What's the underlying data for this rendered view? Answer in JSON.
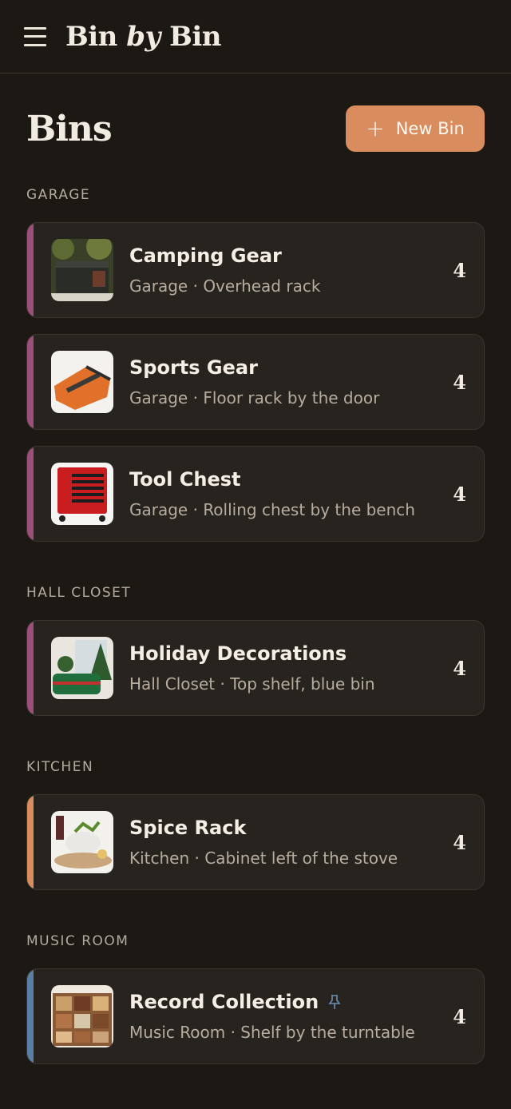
{
  "app": {
    "title_part1": "Bin ",
    "title_part2": "by",
    "title_part3": " Bin"
  },
  "page": {
    "title": "Bins",
    "new_button_label": "New Bin"
  },
  "colors": {
    "background": "#1c1915",
    "card": "#27231e",
    "accent_button": "#d98d5f",
    "garage_accent": "#9b4f79",
    "hall_closet_accent": "#9b4f79",
    "kitchen_accent": "#d98d5f",
    "music_room_accent": "#5a7fa5"
  },
  "sections": [
    {
      "label": "GARAGE",
      "bins": [
        {
          "title": "Camping Gear",
          "location": "Garage",
          "detail": "Overhead rack",
          "count": "4",
          "icon": "camping-gear-thumbnail"
        },
        {
          "title": "Sports Gear",
          "location": "Garage",
          "detail": "Floor rack by the door",
          "count": "4",
          "icon": "sports-gear-thumbnail"
        },
        {
          "title": "Tool Chest",
          "location": "Garage",
          "detail": "Rolling chest by the bench",
          "count": "4",
          "icon": "tool-chest-thumbnail"
        }
      ]
    },
    {
      "label": "HALL CLOSET",
      "bins": [
        {
          "title": "Holiday Decorations",
          "location": "Hall Closet",
          "detail": "Top shelf, blue bin",
          "count": "4",
          "icon": "holiday-decorations-thumbnail"
        }
      ]
    },
    {
      "label": "KITCHEN",
      "bins": [
        {
          "title": "Spice Rack",
          "location": "Kitchen",
          "detail": "Cabinet left of the stove",
          "count": "4",
          "icon": "spice-rack-thumbnail"
        }
      ]
    },
    {
      "label": "MUSIC ROOM",
      "bins": [
        {
          "title": "Record Collection",
          "location": "Music Room",
          "detail": "Shelf by the turntable",
          "count": "4",
          "icon": "record-collection-thumbnail",
          "pinned": true
        }
      ]
    }
  ],
  "separator": " · "
}
